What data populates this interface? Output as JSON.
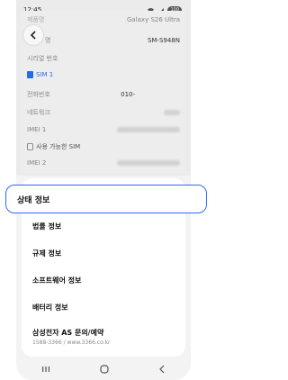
{
  "status_bar": {
    "time": "12:45",
    "battery": "100"
  },
  "top_section": {
    "model_name_label": "제품명",
    "model_name_value": "Galaxy S26 Ultra",
    "model_number_label": "명",
    "model_number_value": "SM-S948N",
    "serial_label": "시리얼 번호",
    "sim1_label": "SIM 1",
    "phone_number_label": "전화번호",
    "phone_number_value": "010-",
    "network_label": "네트워크",
    "imei1_label": "IMEI 1",
    "available_sim_label": "사용 가능한 SIM",
    "imei2_label": "IMEI 2"
  },
  "highlighted_item": {
    "label": "상태 정보"
  },
  "list": {
    "items": [
      {
        "label": "법률 정보"
      },
      {
        "label": "규제 정보"
      },
      {
        "label": "소프트웨어 정보"
      },
      {
        "label": "배터리 정보"
      },
      {
        "label": "삼성전자 AS 문의/예약"
      }
    ],
    "as_sub": "1588-3366 / www.3366.co.kr"
  },
  "colors": {
    "accent": "#2a6df4",
    "sim_badge": "#2a6df4"
  }
}
